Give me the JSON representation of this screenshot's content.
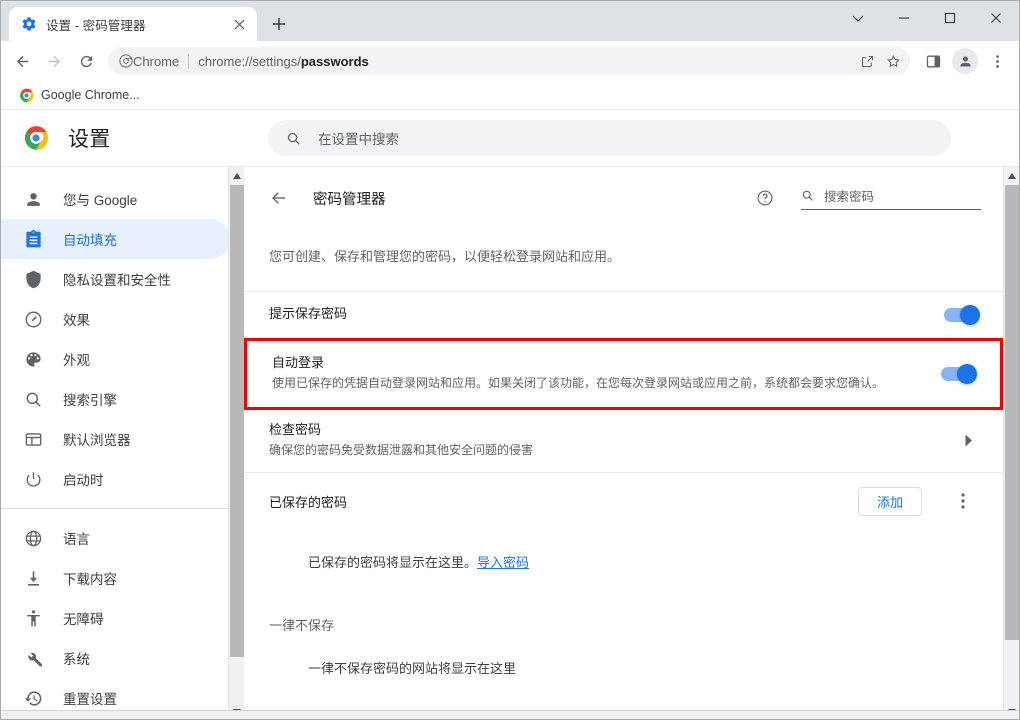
{
  "window": {
    "controls": {
      "tab_search": "tab-search",
      "minimize": "minimize",
      "maximize": "maximize",
      "close": "close"
    }
  },
  "tabstrip": {
    "tabs": [
      {
        "title": "设置 - 密码管理器",
        "favicon": "gear-icon",
        "active": true
      }
    ],
    "new_tab_label": "+"
  },
  "toolbar": {
    "back": "后退",
    "forward": "前进",
    "reload": "重新加载",
    "omnibox": {
      "scheme_label": "Chrome",
      "url_prefix": "chrome://settings/",
      "url_bold": "passwords",
      "share": "share-icon",
      "bookmark": "star-icon"
    },
    "side_panel": "side-panel-icon",
    "profile": "profile-avatar",
    "menu": "chrome-menu"
  },
  "bookmarks": {
    "items": [
      {
        "label": "Google Chrome...",
        "icon": "chrome-icon"
      }
    ]
  },
  "settings_header": {
    "brand_title": "设置",
    "brand_logo": "chrome-logo",
    "search": {
      "placeholder": "在设置中搜索",
      "icon": "search-icon",
      "value": ""
    }
  },
  "sidebar": {
    "groups": [
      {
        "items": [
          {
            "label": "您与 Google",
            "icon": "person-icon",
            "active": false
          },
          {
            "label": "自动填充",
            "icon": "clipboard-icon",
            "active": true
          },
          {
            "label": "隐私设置和安全性",
            "icon": "shield-icon",
            "active": false
          },
          {
            "label": "效果",
            "icon": "speedometer-icon",
            "active": false
          },
          {
            "label": "外观",
            "icon": "palette-icon",
            "active": false
          },
          {
            "label": "搜索引擎",
            "icon": "search-icon",
            "active": false
          },
          {
            "label": "默认浏览器",
            "icon": "browser-icon",
            "active": false
          },
          {
            "label": "启动时",
            "icon": "power-icon",
            "active": false
          }
        ]
      },
      {
        "items": [
          {
            "label": "语言",
            "icon": "globe-icon",
            "active": false
          },
          {
            "label": "下载内容",
            "icon": "download-icon",
            "active": false
          },
          {
            "label": "无障碍",
            "icon": "accessibility-icon",
            "active": false
          },
          {
            "label": "系统",
            "icon": "wrench-icon",
            "active": false
          },
          {
            "label": "重置设置",
            "icon": "history-icon",
            "active": false
          }
        ]
      }
    ]
  },
  "main": {
    "back_icon": "arrow-left-icon",
    "title": "密码管理器",
    "help_icon": "help-circle-icon",
    "password_search": {
      "placeholder": "搜索密码",
      "icon": "search-icon",
      "value": ""
    },
    "intro": "您可创建、保存和管理您的密码，以便轻松登录网站和应用。",
    "offer_save": {
      "title": "提示保存密码",
      "toggle_on": true
    },
    "auto_signin": {
      "title": "自动登录",
      "subtitle": "使用已保存的凭据自动登录网站和应用。如果关闭了该功能，在您每次登录网站或应用之前，系统都会要求您确认。",
      "toggle_on": true,
      "highlighted": true,
      "highlight_color": "#f00000"
    },
    "check_passwords": {
      "title": "检查密码",
      "subtitle": "确保您的密码免受数据泄露和其他安全问题的侵害",
      "arrow_icon": "chevron-right-icon"
    },
    "saved_passwords": {
      "label": "已保存的密码",
      "add_button": "添加",
      "menu_icon": "more-vert-icon",
      "empty_text": "已保存的密码将显示在这里。",
      "import_link": "导入密码"
    },
    "never_saved": {
      "label": "一律不保存",
      "empty_text": "一律不保存密码的网站将显示在这里"
    }
  },
  "colors": {
    "accent": "#1a73e8",
    "accent_light": "#8ab4f8",
    "active_bg": "#e8f0fe",
    "highlight": "#f00000",
    "text_primary": "#202124",
    "text_secondary": "#5f6368"
  }
}
